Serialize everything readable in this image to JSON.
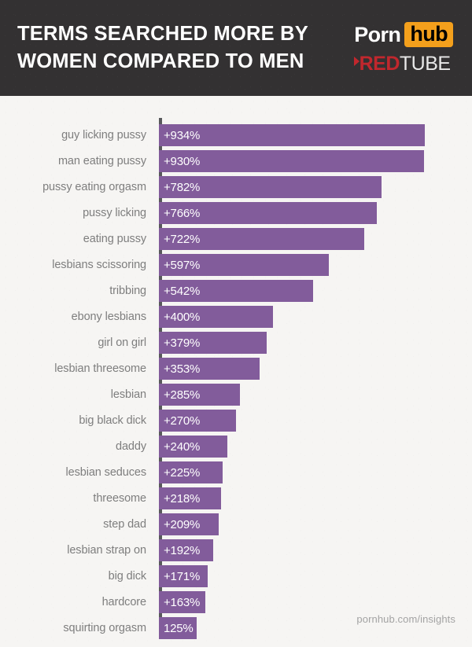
{
  "header": {
    "title_line1": "TERMS SEARCHED MORE BY",
    "title_line2": "WOMEN COMPARED TO MEN",
    "background_color": "#333132",
    "pornhub_logo": {
      "word1": "Porn",
      "word2": "hub",
      "highlight_color": "#f4a01c"
    },
    "redtube_logo": {
      "word1": "RED",
      "word2": "TUBE",
      "accent_color": "#c1272d"
    }
  },
  "footer": {
    "source": "pornhub.com/insights"
  },
  "chart_data": {
    "type": "bar",
    "orientation": "horizontal",
    "title": "TERMS SEARCHED MORE BY WOMEN COMPARED TO MEN",
    "xlabel": "",
    "ylabel": "",
    "grid": false,
    "legend": null,
    "bar_color": "#825c9b",
    "axis_color": "#58595b",
    "background_color": "#f6f5f3",
    "xlim": [
      0,
      934
    ],
    "categories": [
      "guy licking pussy",
      "man eating pussy",
      "pussy eating orgasm",
      "pussy licking",
      "eating pussy",
      "lesbians scissoring",
      "tribbing",
      "ebony lesbians",
      "girl on girl",
      "lesbian threesome",
      "lesbian",
      "big black dick",
      "daddy",
      "lesbian seduces",
      "threesome",
      "step dad",
      "lesbian strap on",
      "big dick",
      "hardcore",
      "squirting orgasm"
    ],
    "values": [
      934,
      930,
      782,
      766,
      722,
      597,
      542,
      400,
      379,
      353,
      285,
      270,
      240,
      225,
      218,
      209,
      192,
      171,
      163,
      125
    ],
    "labels": [
      "+934%",
      "+930%",
      "+782%",
      "+766%",
      "+722%",
      "+597%",
      "+542%",
      "+400%",
      "+379%",
      "+353%",
      "+285%",
      "+270%",
      "+240%",
      "+225%",
      "+218%",
      "+209%",
      "+192%",
      "+171%",
      "+163%",
      "125%"
    ]
  }
}
